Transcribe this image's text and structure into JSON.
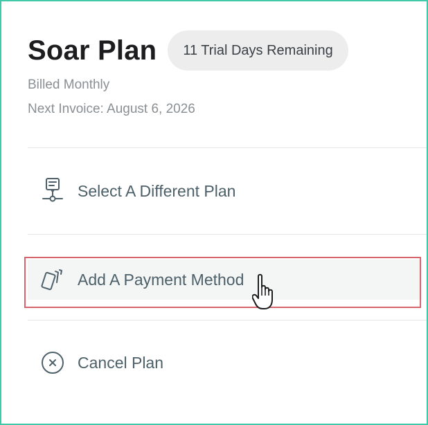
{
  "plan": {
    "title": "Soar Plan",
    "trial_badge": "11 Trial Days Remaining",
    "billing_cycle": "Billed Monthly",
    "next_invoice": "Next Invoice: August 6, 2026"
  },
  "actions": [
    {
      "label": "Select A Different Plan",
      "icon": "plan-select-icon"
    },
    {
      "label": "Add A Payment Method",
      "icon": "payment-cards-icon"
    },
    {
      "label": "Cancel Plan",
      "icon": "cancel-circle-icon"
    }
  ],
  "colors": {
    "frame_border": "#3fc9a9",
    "highlight": "#d7636c",
    "action_text": "#4d6069",
    "badge_bg": "#ededed"
  },
  "cursor": {
    "icon": "hand-pointer-icon"
  }
}
